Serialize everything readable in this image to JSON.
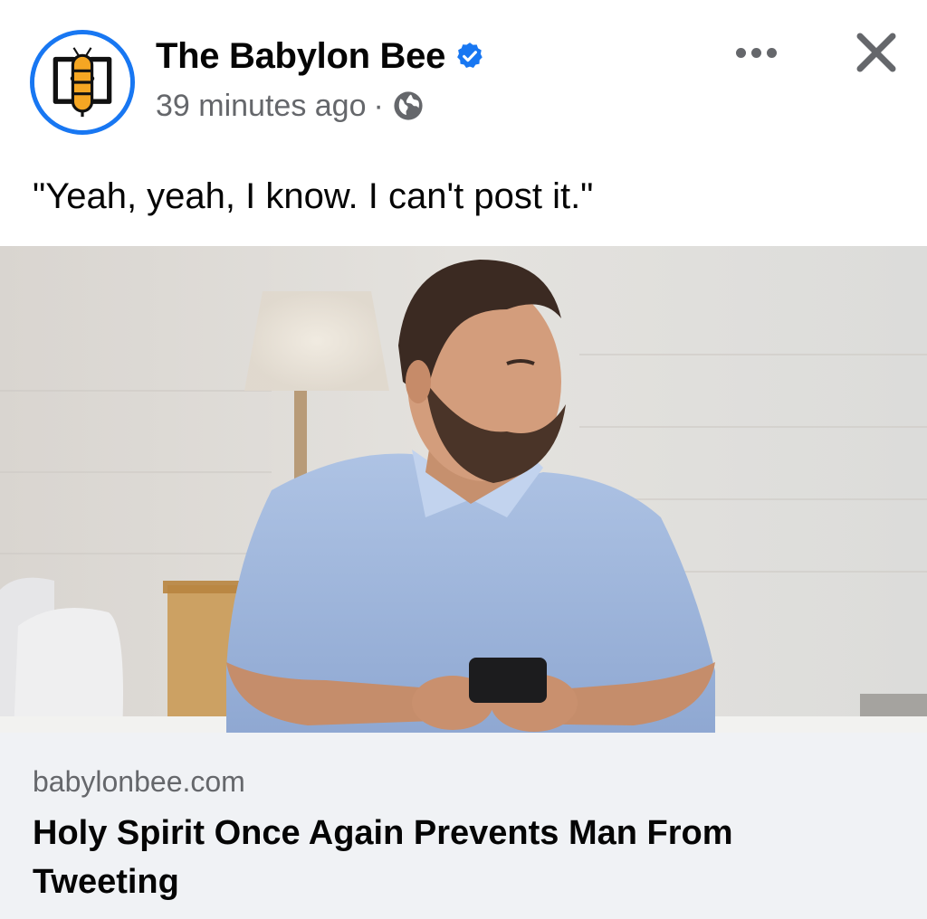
{
  "post": {
    "author": "The Babylon Bee",
    "timestamp": "39 minutes ago",
    "separator": "·",
    "audience_icon": "globe-icon",
    "verified_icon": "verified-badge-icon",
    "caption": "\"Yeah, yeah, I know. I can't post it.\""
  },
  "actions": {
    "more_icon": "more-options-icon",
    "close_icon": "close-icon"
  },
  "link": {
    "domain": "babylonbee.com",
    "headline": "Holy Spirit Once Again Prevents Man From Tweeting"
  },
  "colors": {
    "accent": "#1877f2",
    "secondary_text": "#65676b",
    "footer_bg": "#f0f2f5",
    "logo_yellow": "#f5a623"
  }
}
